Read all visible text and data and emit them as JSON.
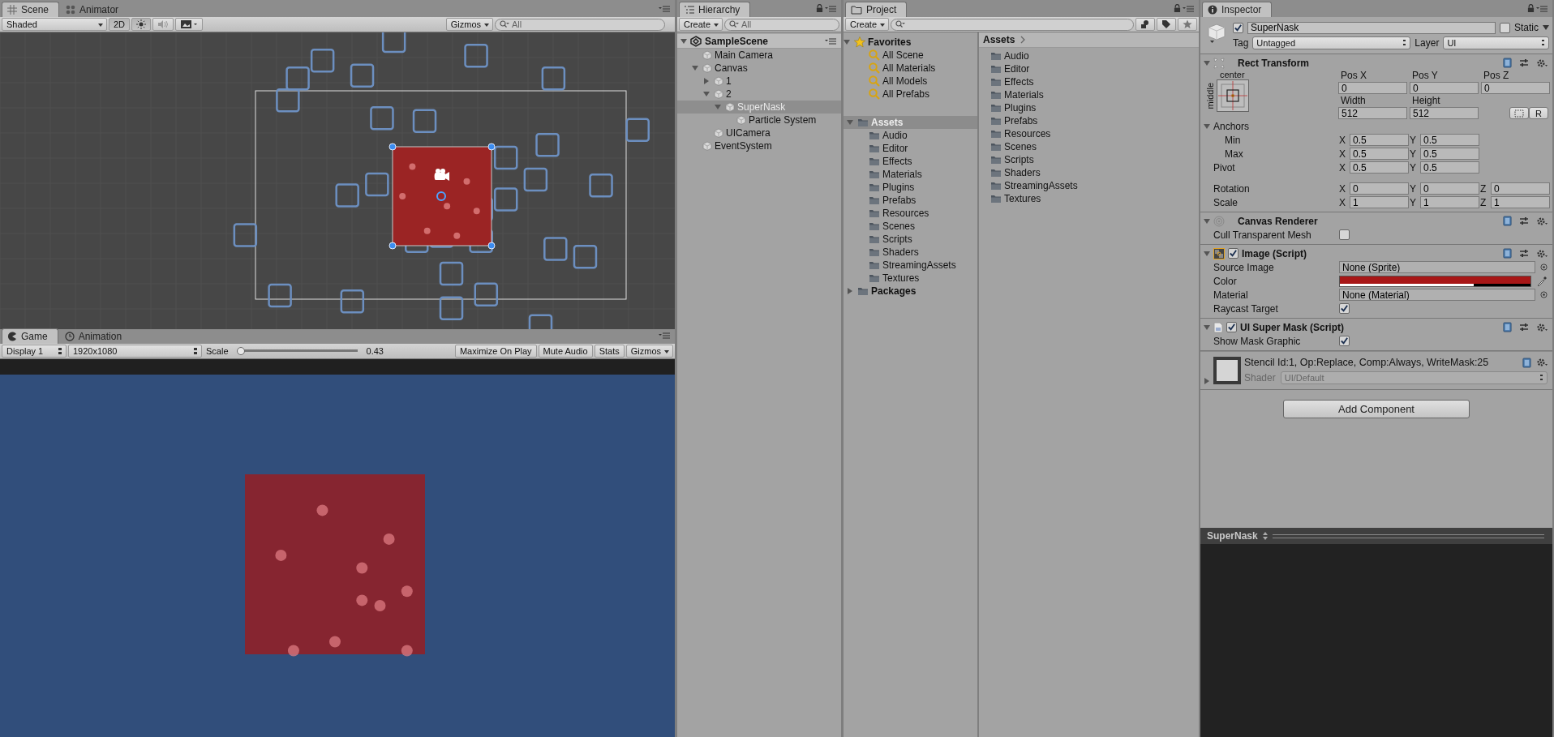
{
  "scene_panel": {
    "tabs": [
      {
        "label": "Scene",
        "selected": true
      },
      {
        "label": "Animator",
        "selected": false
      }
    ],
    "toolbar": {
      "draw_mode": "Shaded",
      "mode_2d": "2D",
      "gizmos": "Gizmos",
      "search_placeholder": "All"
    }
  },
  "game_panel": {
    "tabs": [
      {
        "label": "Game",
        "selected": true
      },
      {
        "label": "Animation",
        "selected": false
      }
    ],
    "toolbar": {
      "display": "Display 1",
      "resolution": "1920x1080",
      "scale_label": "Scale",
      "scale": {
        "level": 0
      },
      "scale_value": "0.43",
      "buttons": [
        "Maximize On Play",
        "Mute Audio",
        "Stats",
        "Gizmos"
      ]
    }
  },
  "hierarchy": {
    "tab": "Hierarchy",
    "create": "Create",
    "search_placeholder": "All",
    "scene": "SampleScene",
    "scene_expanded": true,
    "items": [
      {
        "label": "Main Camera",
        "selected": false
      },
      {
        "label": "Canvas",
        "selected": false,
        "expanded": true,
        "children": [
          {
            "label": "1",
            "selected": false,
            "expanded": false
          },
          {
            "label": "2",
            "selected": false,
            "expanded": true,
            "children": [
              {
                "label": "SuperNask",
                "selected": true,
                "expanded": true,
                "children": [
                  {
                    "label": "Particle System",
                    "selected": false
                  }
                ]
              }
            ]
          },
          {
            "label": "UICamera",
            "selected": false
          }
        ]
      },
      {
        "label": "EventSystem",
        "selected": false
      }
    ]
  },
  "project": {
    "tab": "Project",
    "create": "Create",
    "favorites": {
      "label": "Favorites",
      "expanded": true,
      "items": [
        {
          "label": "All Scene",
          "selected": false
        },
        {
          "label": "All Materials",
          "selected": false
        },
        {
          "label": "All Models",
          "selected": false
        },
        {
          "label": "All Prefabs",
          "selected": false
        }
      ]
    },
    "roots": [
      {
        "label": "Assets",
        "selected": true,
        "expanded": true,
        "children": [
          {
            "label": "Audio",
            "selected": false
          },
          {
            "label": "Editor",
            "selected": false
          },
          {
            "label": "Effects",
            "selected": false
          },
          {
            "label": "Materials",
            "selected": false
          },
          {
            "label": "Plugins",
            "selected": false
          },
          {
            "label": "Prefabs",
            "selected": false
          },
          {
            "label": "Resources",
            "selected": false
          },
          {
            "label": "Scenes",
            "selected": false
          },
          {
            "label": "Scripts",
            "selected": false
          },
          {
            "label": "Shaders",
            "selected": false
          },
          {
            "label": "StreamingAssets",
            "selected": false
          },
          {
            "label": "Textures",
            "selected": false
          }
        ]
      },
      {
        "label": "Packages",
        "selected": false,
        "expanded": false
      }
    ],
    "breadcrumb": "Assets",
    "folders": [
      {
        "label": "Audio",
        "selected": false
      },
      {
        "label": "Editor",
        "selected": false
      },
      {
        "label": "Effects",
        "selected": false
      },
      {
        "label": "Materials",
        "selected": false
      },
      {
        "label": "Plugins",
        "selected": false
      },
      {
        "label": "Prefabs",
        "selected": false
      },
      {
        "label": "Resources",
        "selected": false
      },
      {
        "label": "Scenes",
        "selected": false
      },
      {
        "label": "Scripts",
        "selected": false
      },
      {
        "label": "Shaders",
        "selected": false
      },
      {
        "label": "StreamingAssets",
        "selected": false
      },
      {
        "label": "Textures",
        "selected": false
      }
    ]
  },
  "inspector": {
    "tab": "Inspector",
    "object": {
      "active": true,
      "name": "SuperNask",
      "static_label": "Static",
      "static": false,
      "tag_label": "Tag",
      "tag": "Untagged",
      "layer_label": "Layer",
      "layer": "UI"
    },
    "rect_transform": {
      "title": "Rect Transform",
      "expanded": true,
      "anchor_h": "center",
      "anchor_v": "middle",
      "position": [
        {
          "label": "Pos X",
          "value": "0"
        },
        {
          "label": "Pos Y",
          "value": "0"
        },
        {
          "label": "Pos Z",
          "value": "0"
        }
      ],
      "size": [
        {
          "label": "Width",
          "value": "512"
        },
        {
          "label": "Height",
          "value": "512"
        }
      ],
      "raw_button": "R",
      "anchors_label": "Anchors",
      "anchors_expanded": true,
      "vectors": [
        {
          "label": "Min",
          "axes": [
            {
              "axis": "X",
              "value": "0.5"
            },
            {
              "axis": "Y",
              "value": "0.5"
            }
          ]
        },
        {
          "label": "Max",
          "axes": [
            {
              "axis": "X",
              "value": "0.5"
            },
            {
              "axis": "Y",
              "value": "0.5"
            }
          ]
        },
        {
          "label": "Pivot",
          "axes": [
            {
              "axis": "X",
              "value": "0.5"
            },
            {
              "axis": "Y",
              "value": "0.5"
            }
          ]
        },
        {
          "label": "Rotation",
          "axes": [
            {
              "axis": "X",
              "value": "0"
            },
            {
              "axis": "Y",
              "value": "0"
            },
            {
              "axis": "Z",
              "value": "0"
            }
          ]
        },
        {
          "label": "Scale",
          "axes": [
            {
              "axis": "X",
              "value": "1"
            },
            {
              "axis": "Y",
              "value": "1"
            },
            {
              "axis": "Z",
              "value": "1"
            }
          ]
        }
      ]
    },
    "canvas_renderer": {
      "title": "Canvas Renderer",
      "expanded": true,
      "cull_label": "Cull Transparent Mesh",
      "cull": false
    },
    "image": {
      "title": "Image (Script)",
      "expanded": true,
      "enabled": true,
      "source_label": "Source Image",
      "source": "None (Sprite)",
      "color_label": "Color",
      "color": "#a81717",
      "alpha": {
        "level": 0.7
      },
      "material_label": "Material",
      "material": "None (Material)",
      "raycast_label": "Raycast Target",
      "raycast": true
    },
    "super_mask": {
      "title": "UI Super Mask (Script)",
      "expanded": true,
      "enabled": true,
      "show_label": "Show Mask Graphic",
      "show": true
    },
    "material": {
      "summary": "Stencil Id:1, Op:Replace, Comp:Always, WriteMask:25",
      "shader_label": "Shader",
      "shader": "UI/Default",
      "expanded": false
    },
    "add_component": "Add Component",
    "preview": {
      "title": "SuperNask"
    }
  }
}
